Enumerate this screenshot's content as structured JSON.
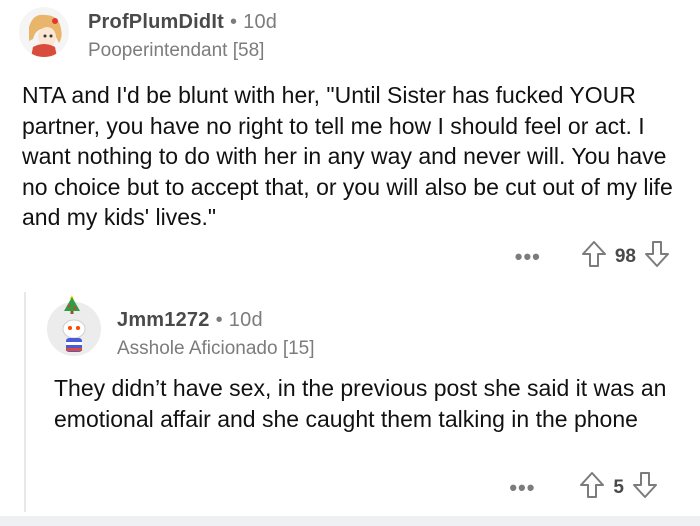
{
  "comment": {
    "username": "ProfPlumDidIt",
    "time": "10d",
    "flair": "Pooperintendant [58]",
    "body": "NTA and I'd be blunt with her, \"Until Sister has fucked YOUR partner, you have no right to tell me how I should feel or act. I want nothing to do with her in any way and never will. You have no choice but to accept that, or you will also be cut out of my life and my kids' lives.\"",
    "more_label": "•••",
    "score": "98"
  },
  "reply": {
    "username": "Jmm1272",
    "time": "10d",
    "flair": "Asshole Aficionado [15]",
    "body": "They didn’t have sex, in the previous post she said it was an emotional affair and she caught them talking in the phone",
    "more_label": "•••",
    "score": "5"
  },
  "separator": "•",
  "icons": {
    "upvote": "upvote-arrow-icon",
    "downvote": "downvote-arrow-icon",
    "more": "more-options-icon"
  }
}
